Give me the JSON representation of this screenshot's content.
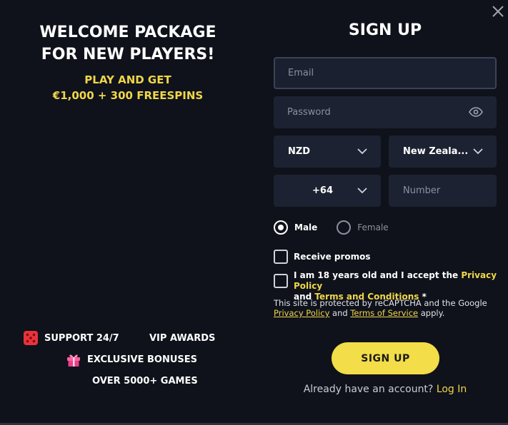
{
  "left": {
    "welcome_line1": "WELCOME PACKAGE",
    "welcome_line2": "FOR NEW PLAYERS!",
    "promo_line1": "PLAY AND GET",
    "promo_line2": "€1,000 + 300 FREESPINS",
    "features": {
      "support": "SUPPORT 24/7",
      "vip": "VIP AWARDS",
      "bonuses": "EXCLUSIVE BONUSES",
      "games": "OVER 5000+ GAMES"
    }
  },
  "form": {
    "title": "SIGN UP",
    "email_placeholder": "Email",
    "password_placeholder": "Password",
    "currency": "NZD",
    "country": "New Zeala...",
    "phone_code": "+64",
    "number_placeholder": "Number",
    "gender": {
      "male": "Male",
      "female": "Female",
      "selected": "male"
    },
    "receive_promos": "Receive promos",
    "terms_prefix": "I am 18 years old and I accept the",
    "privacy_policy": "Privacy Policy",
    "and": "and",
    "terms_conditions": "Terms and Conditions",
    "required_mark": "*",
    "recaptcha_text": "This site is protected by reCAPTCHA and the Google",
    "recaptcha_privacy": "Privacy Policy",
    "recaptcha_and": "and",
    "recaptcha_terms": "Terms of Service",
    "recaptcha_suffix": "apply.",
    "submit": "SIGN UP",
    "have_account": "Already have an account?",
    "login": "Log In"
  },
  "colors": {
    "background": "#0f121a",
    "field": "#1c2232",
    "accent": "#f0d64a",
    "button": "#f3dd48"
  },
  "icons": {
    "close": "close-icon",
    "eye": "eye-icon",
    "chevron": "chevron-down-icon",
    "dice": "dice-icon",
    "gift": "gift-icon"
  }
}
